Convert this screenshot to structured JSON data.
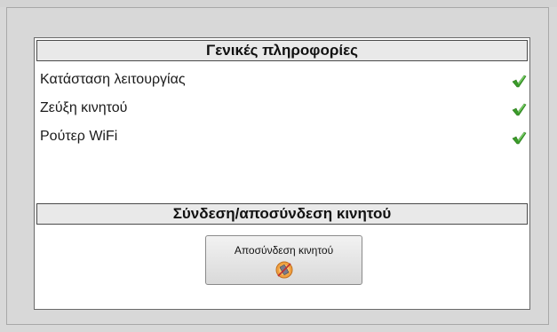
{
  "general_info": {
    "title": "Γενικές πληροφορίες",
    "items": [
      {
        "label": "Κατάσταση λειτουργίας",
        "status": "ok",
        "icon": "checkmark-icon"
      },
      {
        "label": "Ζεύξη κινητού",
        "status": "ok",
        "icon": "checkmark-icon"
      },
      {
        "label": "Ρούτερ WiFi",
        "status": "ok",
        "icon": "checkmark-icon"
      }
    ]
  },
  "phone_connection": {
    "title": "Σύνδεση/αποσύνδεση κινητού",
    "disconnect_label": "Αποσύνδεση κινητού",
    "disconnect_icon": "phone-disconnect-icon"
  },
  "colors": {
    "check_green": "#3a9a2a",
    "header_bg": "#e9e9e9",
    "page_bg": "#d8d8d8"
  }
}
